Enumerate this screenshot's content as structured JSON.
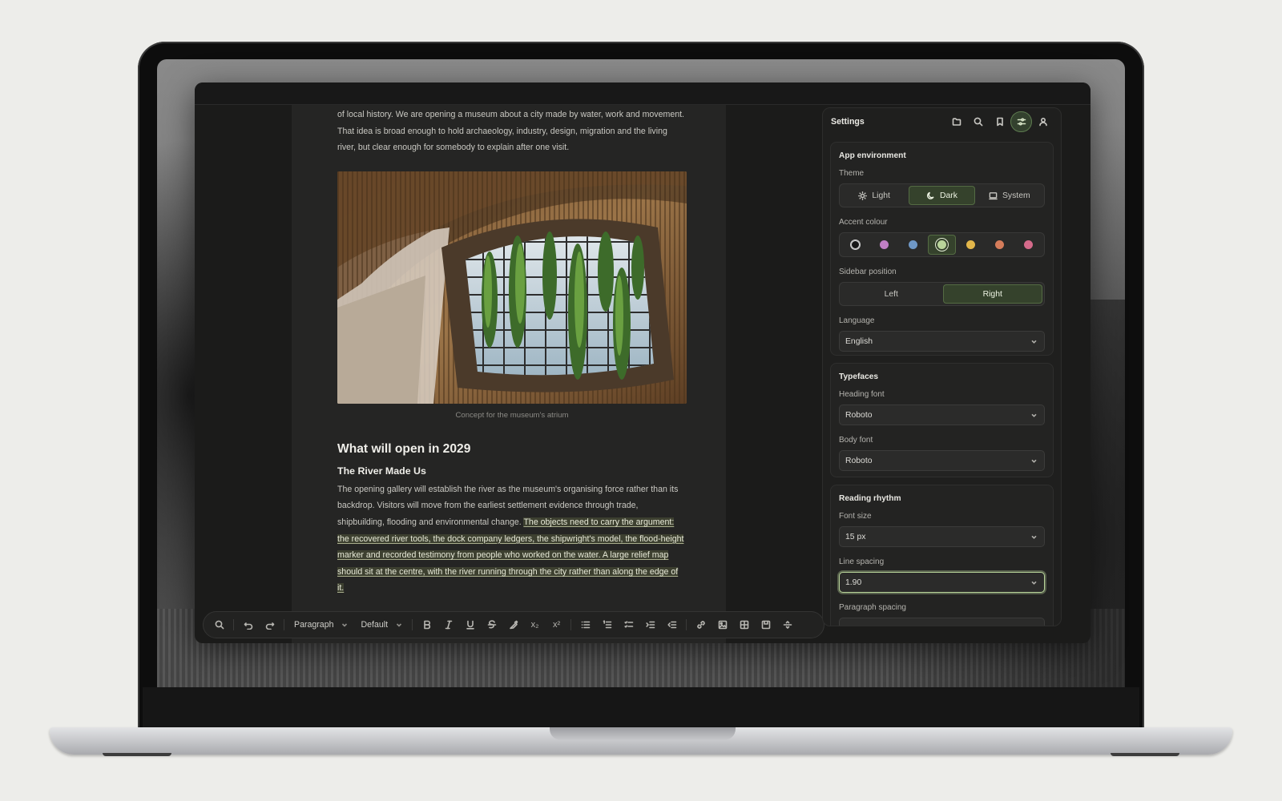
{
  "document": {
    "intro_paragraph": "of local history. We are opening a museum about a city made by water, work and movement. That idea is broad enough to hold archaeology, industry, design, migration and the living river, but clear enough for somebody to explain after one visit.",
    "figure_caption": "Concept for the museum's atrium",
    "heading": "What will open in 2029",
    "subheading": "The River Made Us",
    "body_plain": "The opening gallery will establish the river as the museum's organising force rather than its backdrop. Visitors will move from the earliest settlement evidence through trade, shipbuilding, flooding and environmental change. ",
    "body_highlighted": "The objects need to carry the argument: the recovered river tools, the dock company ledgers, the shipwright's model, the flood-height marker and recorded testimony from people who worked on the water. A large relief map should sit at the centre, with the river running through the city rather than along the edge of it."
  },
  "toolbar": {
    "block_type": "Paragraph",
    "style": "Default",
    "subscript_label": "x₂",
    "superscript_label": "x²"
  },
  "settings": {
    "title": "Settings",
    "app_environment": {
      "title": "App environment",
      "theme_label": "Theme",
      "theme_options": [
        "Light",
        "Dark",
        "System"
      ],
      "theme_selected": "Dark",
      "accent_label": "Accent colour",
      "accent_colors": [
        "#161616",
        "#c07fc4",
        "#6f98c6",
        "#b9d59a",
        "#e2b64a",
        "#d57c5a",
        "#d46a8a"
      ],
      "accent_selected_index": 3,
      "sidebar_label": "Sidebar position",
      "sidebar_options": [
        "Left",
        "Right"
      ],
      "sidebar_selected": "Right",
      "language_label": "Language",
      "language_value": "English"
    },
    "typefaces": {
      "title": "Typefaces",
      "heading_font_label": "Heading font",
      "heading_font_value": "Roboto",
      "body_font_label": "Body font",
      "body_font_value": "Roboto"
    },
    "reading_rhythm": {
      "title": "Reading rhythm",
      "font_size_label": "Font size",
      "font_size_value": "15 px",
      "line_spacing_label": "Line spacing",
      "line_spacing_value": "1.90",
      "paragraph_spacing_label": "Paragraph spacing"
    }
  },
  "colors": {
    "accent": "#b9d59a",
    "accent_fill": "#35422c",
    "app_background": "#1b1b1a",
    "document_background": "#252524"
  }
}
